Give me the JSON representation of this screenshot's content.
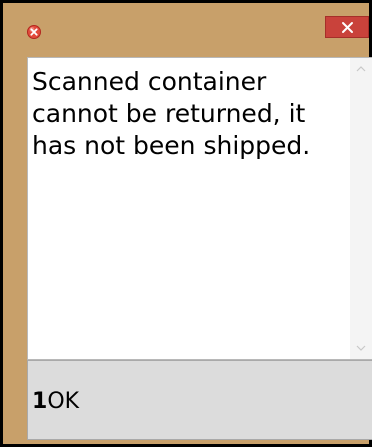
{
  "window": {
    "icon": "error-icon",
    "close_label": "×",
    "close_icon": "close-icon"
  },
  "message": {
    "text": "Scanned container cannot be returned, it has not been shipped."
  },
  "ok_button": {
    "number": "1",
    "label": "OK"
  },
  "colors": {
    "frame": "#c8a06a",
    "close_button": "#c9423b",
    "content_background": "#ffffff",
    "button_background": "#dcdcdc"
  }
}
